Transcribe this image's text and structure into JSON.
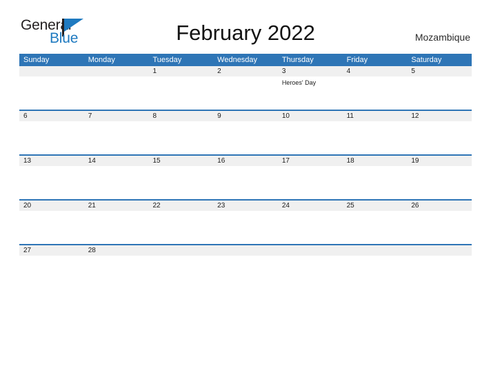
{
  "logo": {
    "word_one": "General",
    "word_two": "Blue",
    "flag_icon": "blue-flag-icon"
  },
  "header": {
    "title": "February 2022",
    "country": "Mozambique"
  },
  "colors": {
    "header_blue": "#2e75b6",
    "row_divider_blue": "#2e75b6",
    "date_band_gray": "#f0f0f0",
    "logo_blue": "#1f7ac0",
    "text_dark": "#1a1a1a",
    "page_background": "#ffffff"
  },
  "calendar": {
    "month": "February",
    "year": "2022",
    "weekday_headers": [
      "Sunday",
      "Monday",
      "Tuesday",
      "Wednesday",
      "Thursday",
      "Friday",
      "Saturday"
    ],
    "weeks": [
      {
        "days": [
          {
            "date": "",
            "events": []
          },
          {
            "date": "",
            "events": []
          },
          {
            "date": "1",
            "events": []
          },
          {
            "date": "2",
            "events": []
          },
          {
            "date": "3",
            "events": [
              "Heroes' Day"
            ]
          },
          {
            "date": "4",
            "events": []
          },
          {
            "date": "5",
            "events": []
          }
        ]
      },
      {
        "days": [
          {
            "date": "6",
            "events": []
          },
          {
            "date": "7",
            "events": []
          },
          {
            "date": "8",
            "events": []
          },
          {
            "date": "9",
            "events": []
          },
          {
            "date": "10",
            "events": []
          },
          {
            "date": "11",
            "events": []
          },
          {
            "date": "12",
            "events": []
          }
        ]
      },
      {
        "days": [
          {
            "date": "13",
            "events": []
          },
          {
            "date": "14",
            "events": []
          },
          {
            "date": "15",
            "events": []
          },
          {
            "date": "16",
            "events": []
          },
          {
            "date": "17",
            "events": []
          },
          {
            "date": "18",
            "events": []
          },
          {
            "date": "19",
            "events": []
          }
        ]
      },
      {
        "days": [
          {
            "date": "20",
            "events": []
          },
          {
            "date": "21",
            "events": []
          },
          {
            "date": "22",
            "events": []
          },
          {
            "date": "23",
            "events": []
          },
          {
            "date": "24",
            "events": []
          },
          {
            "date": "25",
            "events": []
          },
          {
            "date": "26",
            "events": []
          }
        ]
      },
      {
        "days": [
          {
            "date": "27",
            "events": []
          },
          {
            "date": "28",
            "events": []
          },
          {
            "date": "",
            "events": []
          },
          {
            "date": "",
            "events": []
          },
          {
            "date": "",
            "events": []
          },
          {
            "date": "",
            "events": []
          },
          {
            "date": "",
            "events": []
          }
        ]
      }
    ]
  }
}
